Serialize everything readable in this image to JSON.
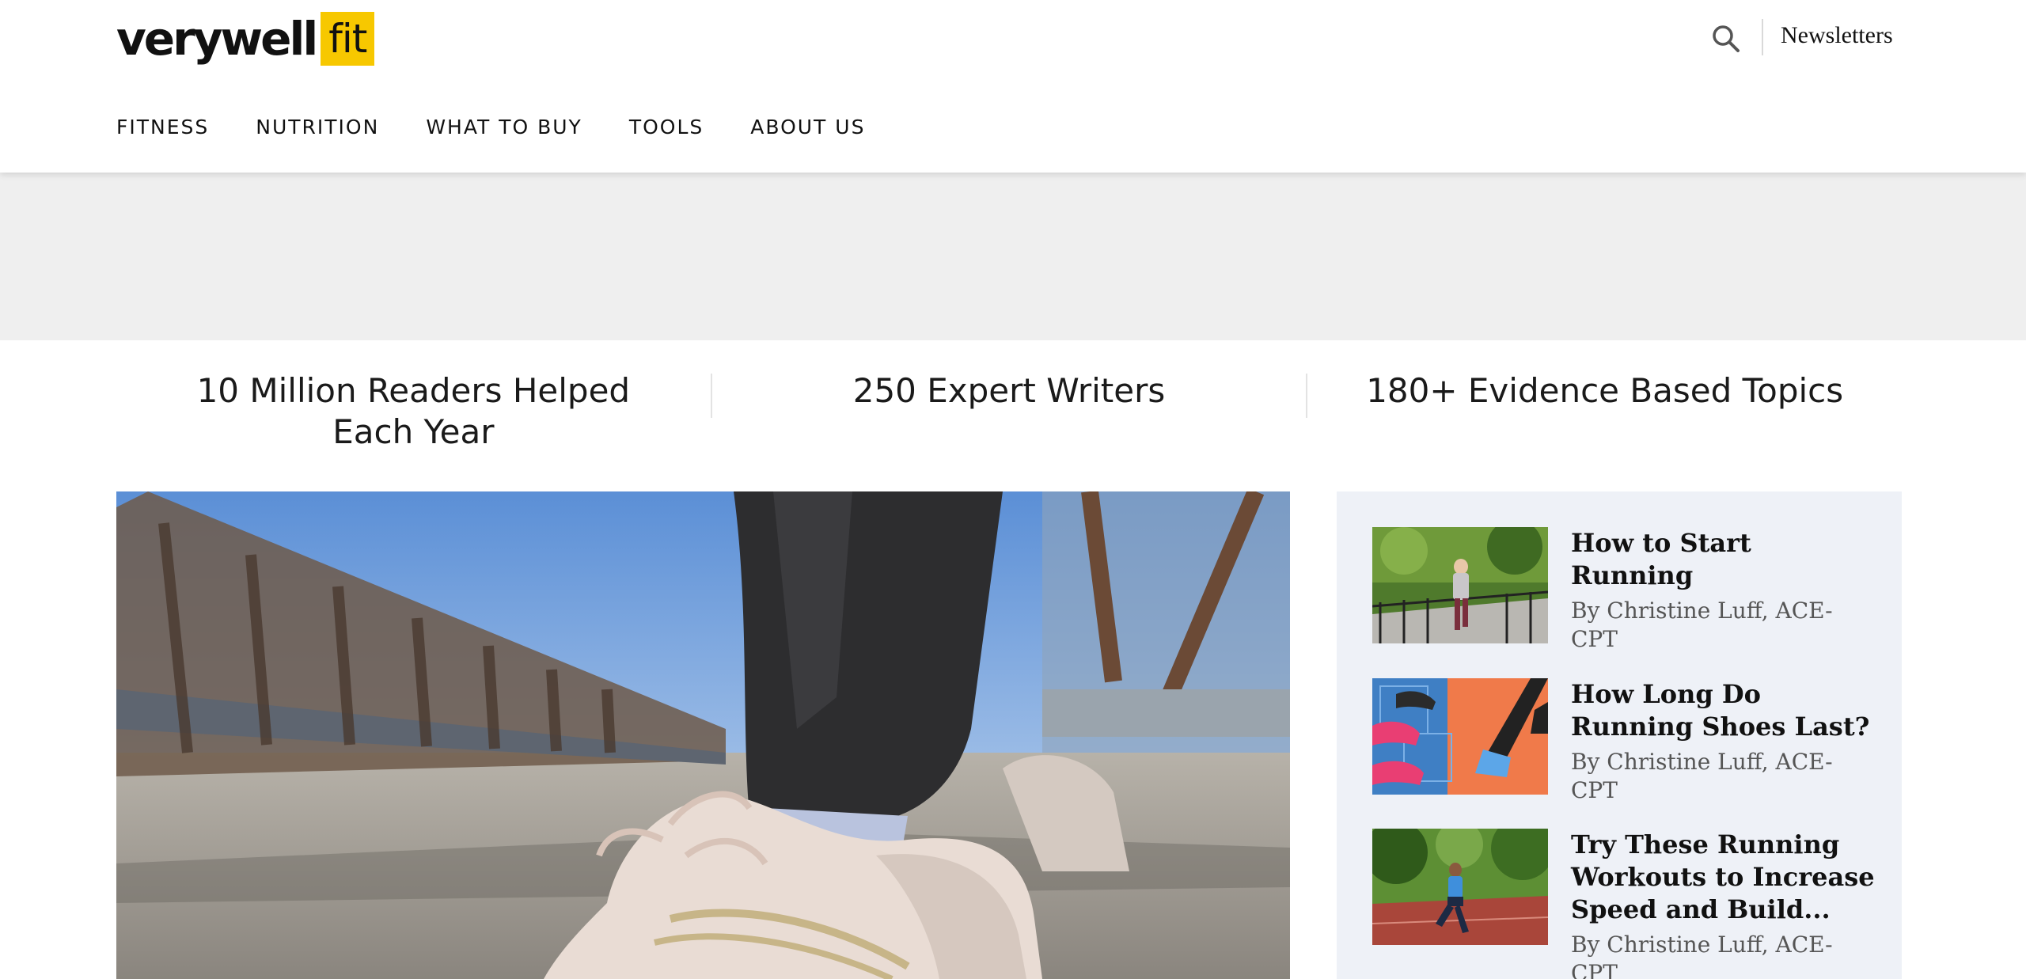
{
  "header": {
    "logo_word": "verywell",
    "logo_box": "fit",
    "newsletters_label": "Newsletters",
    "search_icon": "search-icon"
  },
  "nav": {
    "items": [
      {
        "label": "FITNESS"
      },
      {
        "label": "NUTRITION"
      },
      {
        "label": "WHAT TO BUY"
      },
      {
        "label": "TOOLS"
      },
      {
        "label": "ABOUT US"
      }
    ]
  },
  "stats": [
    {
      "text": "10 Million Readers Helped Each Year"
    },
    {
      "text": "250 Expert Writers"
    },
    {
      "text": "180+ Evidence Based Topics"
    }
  ],
  "sidebar": {
    "articles": [
      {
        "title": "How to Start Running",
        "byline": "By Christine Luff, ACE-CPT"
      },
      {
        "title": "How Long Do Running Shoes Last?",
        "byline": "By Christine Luff, ACE-CPT"
      },
      {
        "title": "Try These Running Workouts to Increase Speed and Build...",
        "byline": "By Christine Luff, ACE-CPT"
      }
    ]
  },
  "colors": {
    "brand_yellow": "#f7c800",
    "ad_band": "#efefef",
    "sidebar_bg": "#eef1f7"
  }
}
